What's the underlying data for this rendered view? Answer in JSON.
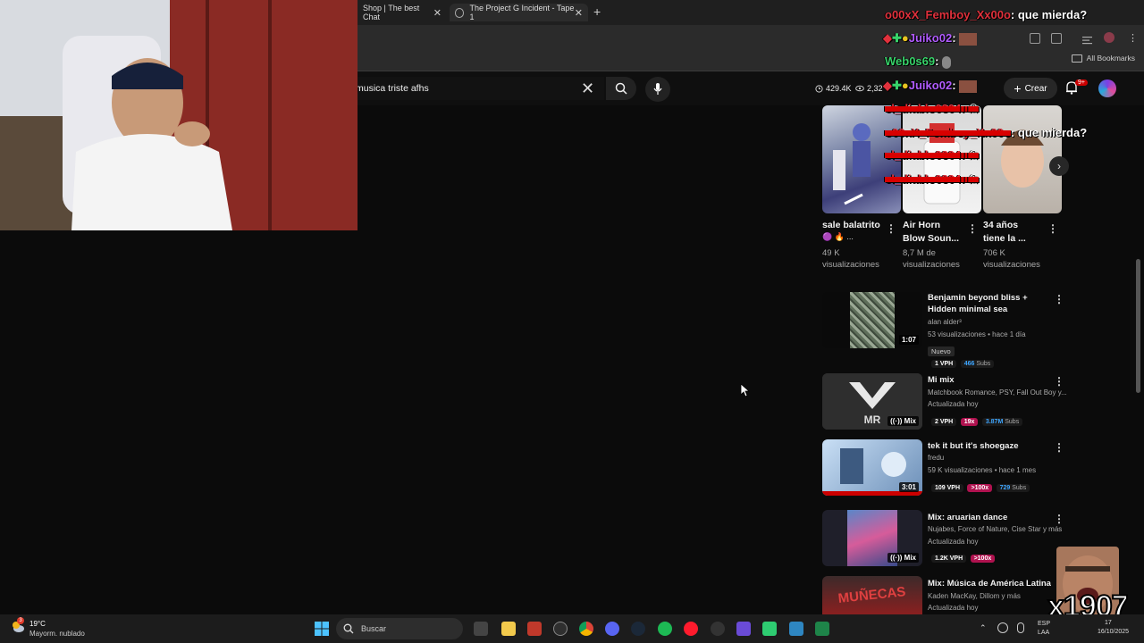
{
  "browser": {
    "tabs": [
      {
        "title": "Shop | The best Chat"
      },
      {
        "title": "The Project G Incident - Tape 1"
      }
    ],
    "bookmarks_label": "All Bookmarks"
  },
  "youtube": {
    "search": {
      "value": "musica triste afhs"
    },
    "stats": {
      "viewers": "429.4K",
      "secondary": "2,32"
    },
    "create_label": "Crear",
    "notif_badge": "9+",
    "shorts": [
      {
        "title": "sale balatrito",
        "subtitle": "🟣 🔥 ...",
        "views": "49 K",
        "views_label": "visualizaciones"
      },
      {
        "title": "Air Horn Blow Soun...",
        "views": "8,7 M de",
        "views_label": "visualizaciones"
      },
      {
        "title": "34 años tiene la ...",
        "views": "706 K",
        "views_label": "visualizaciones"
      }
    ],
    "videos": [
      {
        "title": "Benjamin beyond bliss + Hidden minimal sea",
        "channel": "alan alder³",
        "meta": "53 visualizaciones • hace 1 día",
        "duration": "1:07",
        "nuevo": "Nuevo",
        "vph": "1 VPH",
        "subs": "466",
        "subs_label": "Subs"
      },
      {
        "title": "Mi mix",
        "channel": "Matchbook Romance, PSY, Fall Out Boy y...",
        "meta": "Actualizada hoy",
        "duration": "Mix",
        "vph": "2 VPH",
        "mult": "19x",
        "subs": "3.87M",
        "subs_label": "Subs"
      },
      {
        "title": "tek it but it's shoegaze",
        "channel": "fredu",
        "meta": "59 K visualizaciones • hace 1 mes",
        "duration": "3:01",
        "vph": "109 VPH",
        "mult": ">100x",
        "subs": "729",
        "subs_label": "Subs"
      },
      {
        "title": "Mix: aruarian dance",
        "channel": "Nujabes, Force of Nature, Cise Star y más",
        "meta": "Actualizada hoy",
        "duration": "Mix",
        "vph": "1.2K VPH",
        "mult": ">100x"
      },
      {
        "title": "Mix: Música de América Latina",
        "channel": "Kaden MacKay, Dillom y más",
        "meta": "Actualizada hoy"
      }
    ]
  },
  "chat": [
    {
      "user": "o00xX_Femboy_Xx00o",
      "message": ": que mierda?"
    },
    {
      "user": "Juiko02",
      "message": ":"
    },
    {
      "user": "Web0s69",
      "message": ":"
    },
    {
      "user": "Juiko02",
      "message": ":"
    },
    {
      "user": "el_diablo0304",
      "message": ":"
    },
    {
      "user": "o00xX_Femboy_Xx00o",
      "message": ": que mierda?"
    },
    {
      "user": "el_diablo0304",
      "message": ":"
    },
    {
      "user": "el_diablo0304",
      "message": ":"
    }
  ],
  "overlay": {
    "counter": "x1907"
  },
  "taskbar": {
    "weather_temp": "19°C",
    "weather_desc": "Mayorm. nublado",
    "search_placeholder": "Buscar",
    "lang_1": "ESP",
    "lang_2": "LAA",
    "time": "17",
    "date": "16/10/2025",
    "weather_badge": "3"
  },
  "colors": {
    "mult_badge": "#b0124f",
    "subs_link": "#3ea6ff",
    "chat_red": "#e0313c",
    "chat_purple": "#b15cff",
    "chat_green": "#38d36a"
  }
}
